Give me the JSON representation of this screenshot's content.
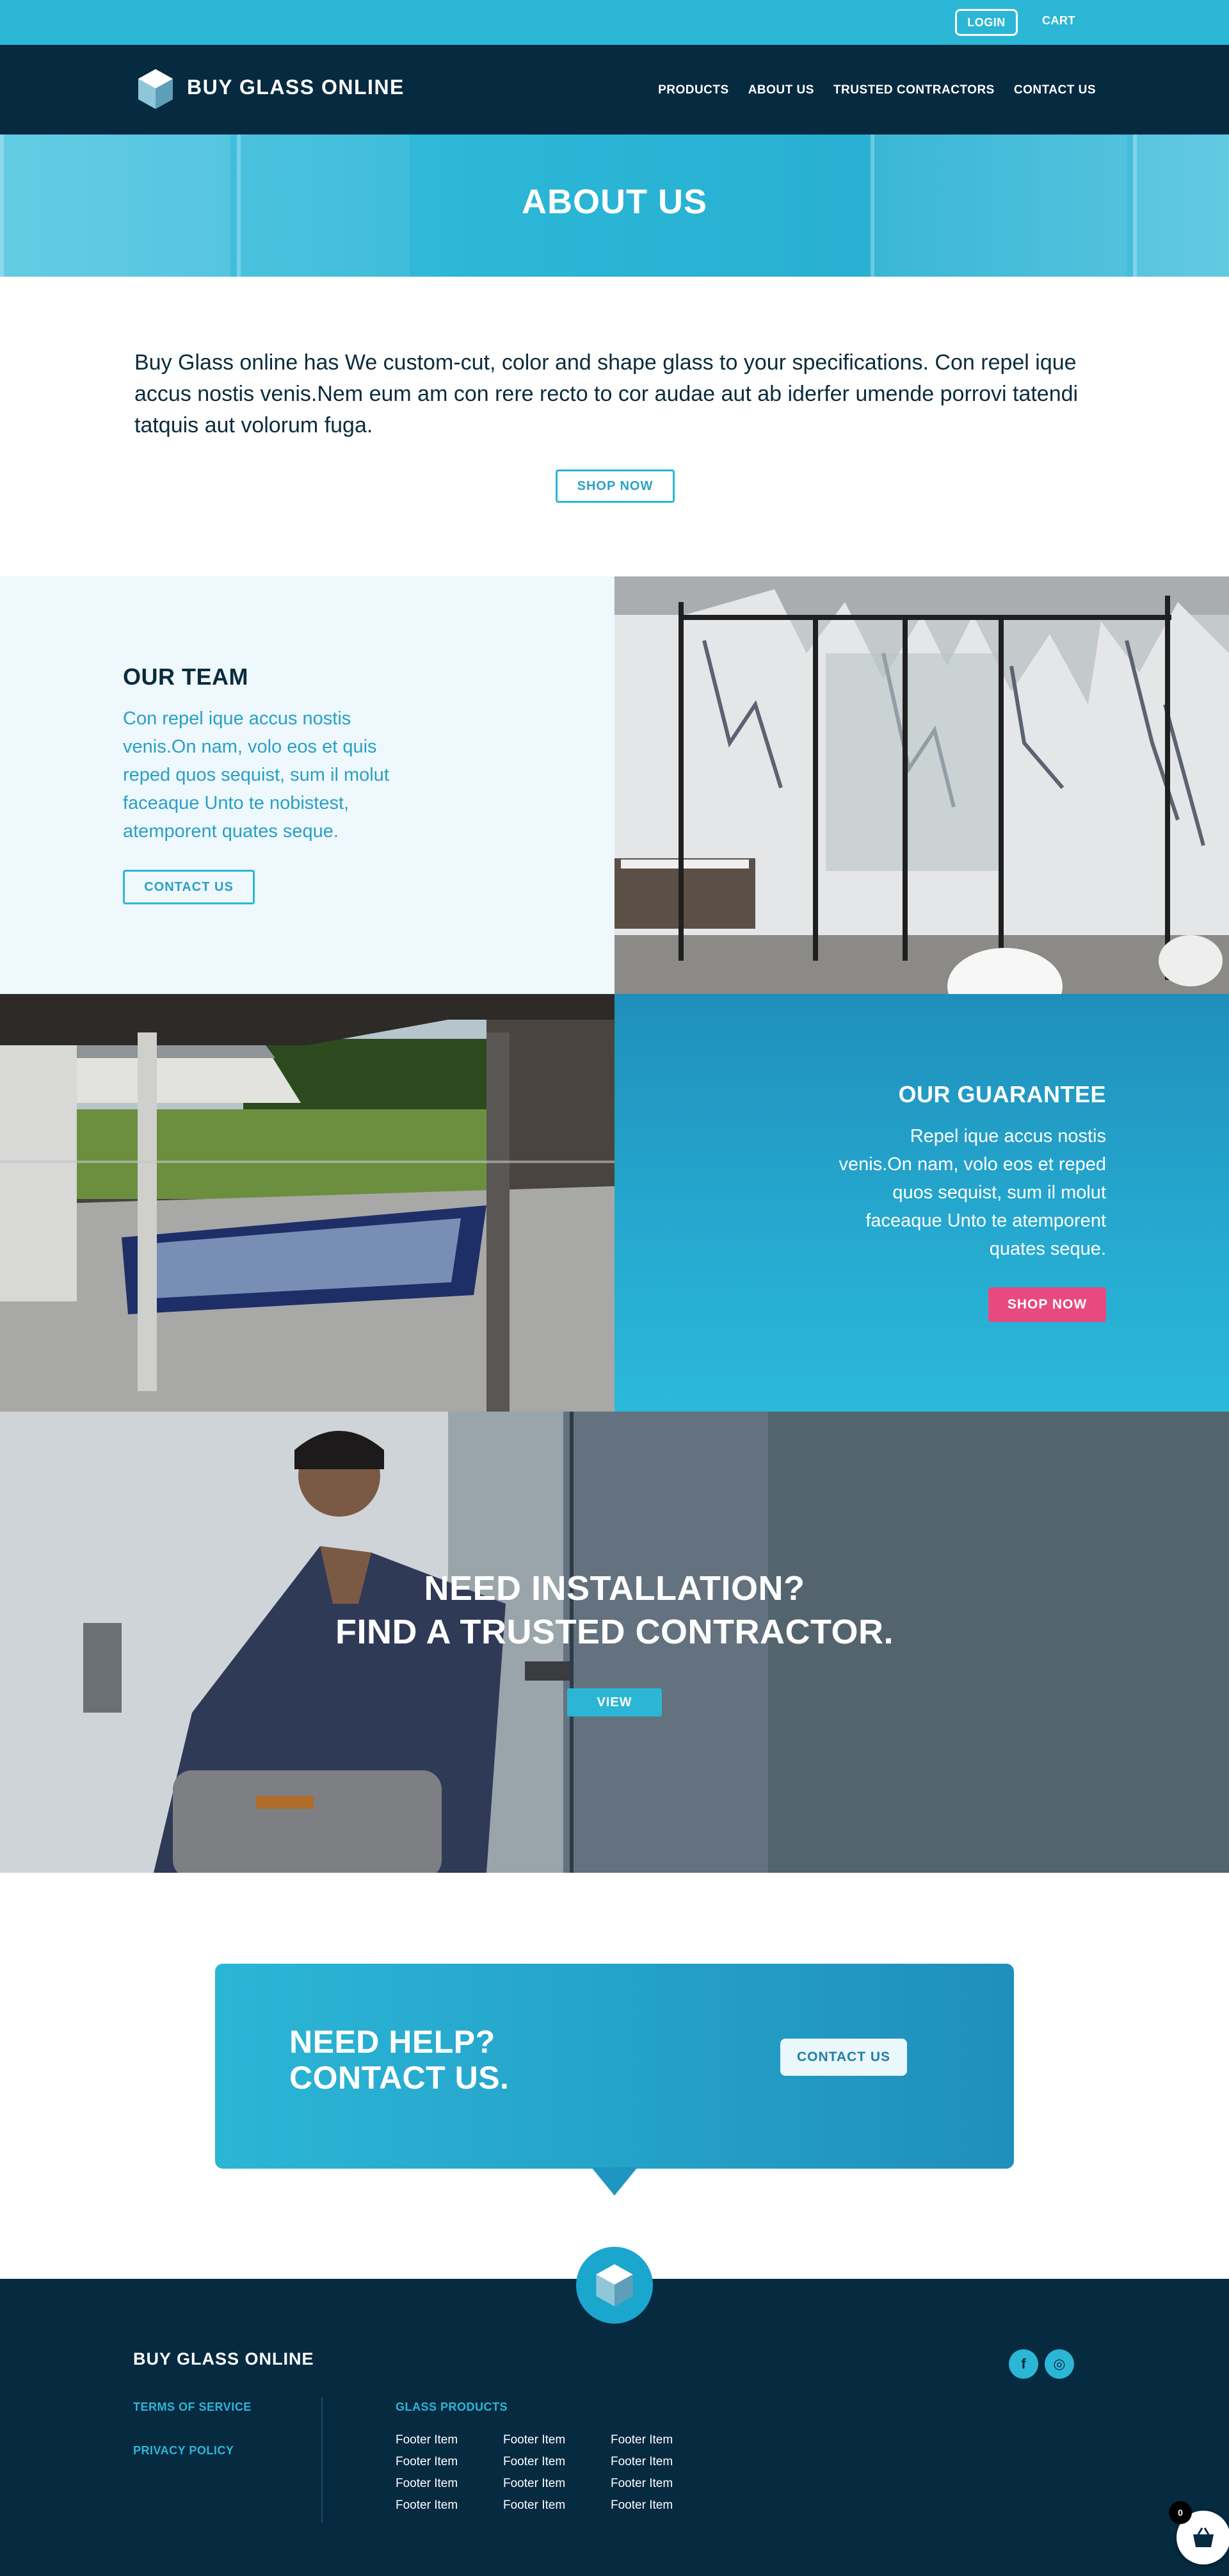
{
  "topbar": {
    "login_label": "LOGIN",
    "cart_label": "CART"
  },
  "header": {
    "brand": "BUY GLASS ONLINE",
    "nav": [
      "PRODUCTS",
      "ABOUT US",
      "TRUSTED CONTRACTORS",
      "CONTACT US"
    ]
  },
  "hero": {
    "title": "ABOUT US"
  },
  "intro": {
    "text": "Buy Glass online has We custom-cut, color and shape glass to your specifications. Con repel ique accus nostis venis.Nem eum am con rere recto to cor audae aut ab iderfer umende porrovi tatendi tatquis aut volorum fuga.",
    "button": "SHOP NOW"
  },
  "team": {
    "title": "OUR TEAM",
    "text": "Con repel ique accus nostis venis.On nam, volo eos et quis reped quos sequist, sum il molut faceaque Unto te nobistest, atemporent quates seque.",
    "button": "CONTACT US"
  },
  "guarantee": {
    "title": "OUR GUARANTEE",
    "text": "Repel ique accus nostis venis.On nam, volo eos et reped quos sequist, sum il molut faceaque Unto te atemporent quates seque.",
    "button": "SHOP NOW"
  },
  "installation": {
    "line1": "NEED INSTALLATION?",
    "line2": "FIND A TRUSTED CONTRACTOR.",
    "button": "VIEW"
  },
  "help": {
    "line1": "NEED HELP?",
    "line2": "CONTACT US.",
    "button": "CONTACT US"
  },
  "footer": {
    "brand": "BUY GLASS ONLINE",
    "links": [
      "TERMS OF SERVICE",
      "PRIVACY POLICY"
    ],
    "products_title": "GLASS PRODUCTS",
    "items": [
      "Footer Item",
      "Footer Item",
      "Footer Item",
      "Footer Item",
      "Footer Item",
      "Footer Item",
      "Footer Item",
      "Footer Item",
      "Footer Item",
      "Footer Item",
      "Footer Item",
      "Footer Item"
    ],
    "social": [
      {
        "icon": "facebook-icon",
        "glyph": "f"
      },
      {
        "icon": "instagram-icon",
        "glyph": "◎"
      }
    ]
  },
  "basket": {
    "count": "0",
    "icon": "basket-icon"
  },
  "colors": {
    "accent": "#2bb6d6",
    "navy": "#062a40",
    "pink": "#e64a7e"
  }
}
